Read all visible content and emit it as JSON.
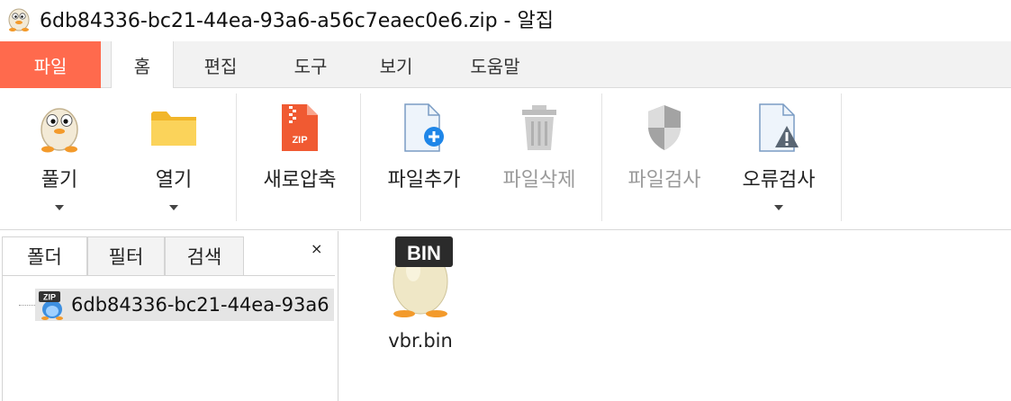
{
  "window": {
    "title": "6db84336-bc21-44ea-93a6-a56c7eaec0e6.zip - 알집",
    "app_icon": "alzip-egg-icon"
  },
  "tabs": [
    {
      "label": "파일",
      "icon": null
    },
    {
      "label": "홈"
    },
    {
      "label": "편집"
    },
    {
      "label": "도구"
    },
    {
      "label": "보기"
    },
    {
      "label": "도움말"
    }
  ],
  "ribbon": {
    "extract": {
      "label": "풀기",
      "icon": "egg-mascot-icon"
    },
    "open": {
      "label": "열기",
      "icon": "folder-icon"
    },
    "new_archive": {
      "label": "새로압축",
      "icon": "zip-file-icon"
    },
    "add_file": {
      "label": "파일추가",
      "icon": "add-file-icon"
    },
    "delete_file": {
      "label": "파일삭제",
      "icon": "trash-icon"
    },
    "scan_file": {
      "label": "파일검사",
      "icon": "shield-icon"
    },
    "error_check": {
      "label": "오류검사",
      "icon": "warning-file-icon"
    }
  },
  "left_pane": {
    "tabs": {
      "folder": "폴더",
      "filter": "필터",
      "search": "검색"
    },
    "close": "×",
    "tree": {
      "archive_label": "6db84336-bc21-44ea-93a6",
      "badge": "ZIP"
    }
  },
  "content": {
    "items": [
      {
        "name": "vbr.bin",
        "badge": "BIN"
      }
    ]
  },
  "colors": {
    "file_tab": "#ff6a4d",
    "tab_bar": "#f2f2f2",
    "selected_row": "#e5e5e5"
  }
}
